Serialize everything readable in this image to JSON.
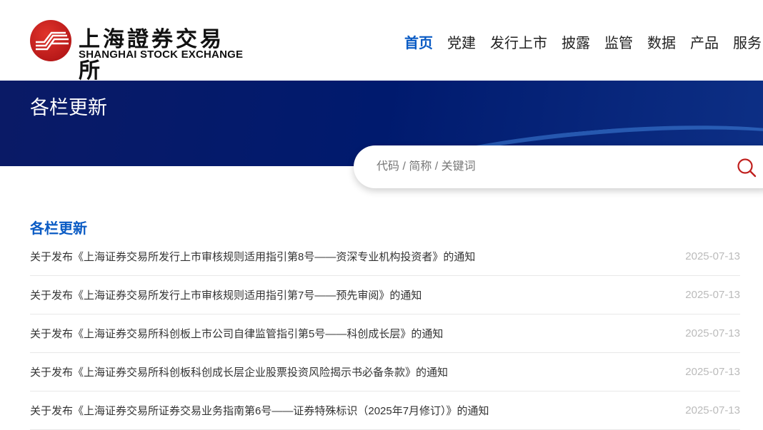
{
  "header": {
    "logo_cn": "上海證券交易所",
    "logo_en": "SHANGHAI STOCK EXCHANGE",
    "nav": [
      "首页",
      "党建",
      "发行上市",
      "披露",
      "监管",
      "数据",
      "产品",
      "服务"
    ]
  },
  "banner": {
    "title": "各栏更新"
  },
  "search": {
    "placeholder": "代码 / 简称 / 关键词"
  },
  "section": {
    "title": "各栏更新",
    "items": [
      {
        "title": "关于发布《上海证券交易所发行上市审核规则适用指引第8号——资深专业机构投资者》的通知",
        "date": "2025-07-13"
      },
      {
        "title": "关于发布《上海证券交易所发行上市审核规则适用指引第7号——预先审阅》的通知",
        "date": "2025-07-13"
      },
      {
        "title": "关于发布《上海证券交易所科创板上市公司自律监管指引第5号——科创成长层》的通知",
        "date": "2025-07-13"
      },
      {
        "title": "关于发布《上海证券交易所科创板科创成长层企业股票投资风险揭示书必备条款》的通知",
        "date": "2025-07-13"
      },
      {
        "title": "关于发布《上海证券交易所证券交易业务指南第6号——证券特殊标识（2025年7月修订）》的通知",
        "date": "2025-07-13"
      }
    ]
  }
}
